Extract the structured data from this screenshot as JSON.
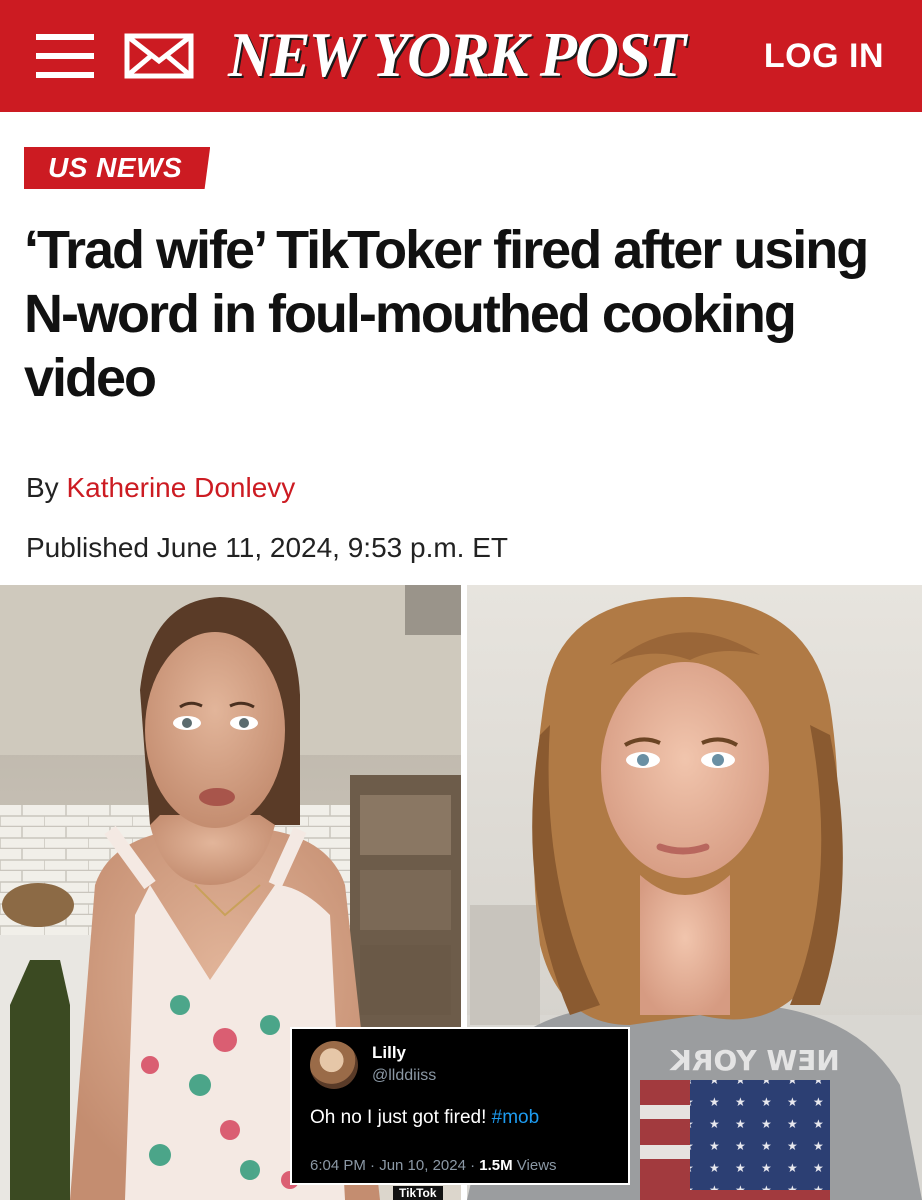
{
  "header": {
    "logo_text": "NEW YORK POST",
    "login_label": "LOG IN",
    "brand_color": "#cc1b22",
    "icons": [
      "menu-icon",
      "mail-icon"
    ]
  },
  "article": {
    "section": "US NEWS",
    "headline": "‘Trad wife’ TikToker fired after using N-word in foul-mouthed cooking video",
    "byline_prefix": "By",
    "author": "Katherine Donlevy",
    "published": "Published June 11, 2024, 9:53 p.m. ET"
  },
  "image": {
    "left_shirt_text": "",
    "right_shirt_text": "NEW YORK",
    "watermark": "TikTok"
  },
  "tweet": {
    "name": "Lilly",
    "handle": "@llddiiss",
    "text": "Oh no I just got fired!",
    "hashtag": "#mob",
    "time": "6:04 PM · Jun 10, 2024 · ",
    "views_count": "1.5M",
    "views_label": " Views"
  }
}
